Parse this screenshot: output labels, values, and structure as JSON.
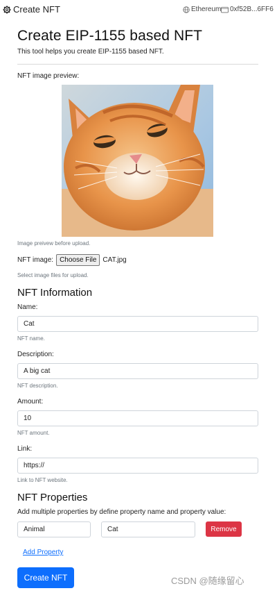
{
  "topbar": {
    "app_name": "Create NFT",
    "network": "Ethereum",
    "account": "0xf52B...6FF6"
  },
  "page": {
    "title": "Create EIP-1155 based NFT",
    "subtitle": "This tool helps you create EIP-1155 based NFT."
  },
  "image": {
    "preview_label": "NFT image preview:",
    "preview_help": "Image preivew before upload.",
    "file_label": "NFT image:",
    "choose_button": "Choose File",
    "file_name": "CAT.jpg",
    "file_help": "Select image files for upload."
  },
  "info": {
    "heading": "NFT Information",
    "name_label": "Name:",
    "name_value": "Cat",
    "name_help": "NFT name.",
    "description_label": "Description:",
    "description_value": "A big cat",
    "description_help": "NFT description.",
    "amount_label": "Amount:",
    "amount_value": "10",
    "amount_help": "NFT amount.",
    "link_label": "Link:",
    "link_value": "https://",
    "link_help": "Link to NFT website."
  },
  "properties": {
    "heading": "NFT Properties",
    "instructions": "Add multiple properties by define property name and property value:",
    "rows": [
      {
        "name": "Animal",
        "value": "Cat",
        "remove_label": "Remove"
      }
    ],
    "add_label": "Add Property"
  },
  "actions": {
    "create_label": "Create NFT"
  },
  "watermark": "CSDN @随缘留心",
  "colors": {
    "primary": "#0d6efd",
    "danger": "#dc3545",
    "muted": "#6c757d"
  }
}
